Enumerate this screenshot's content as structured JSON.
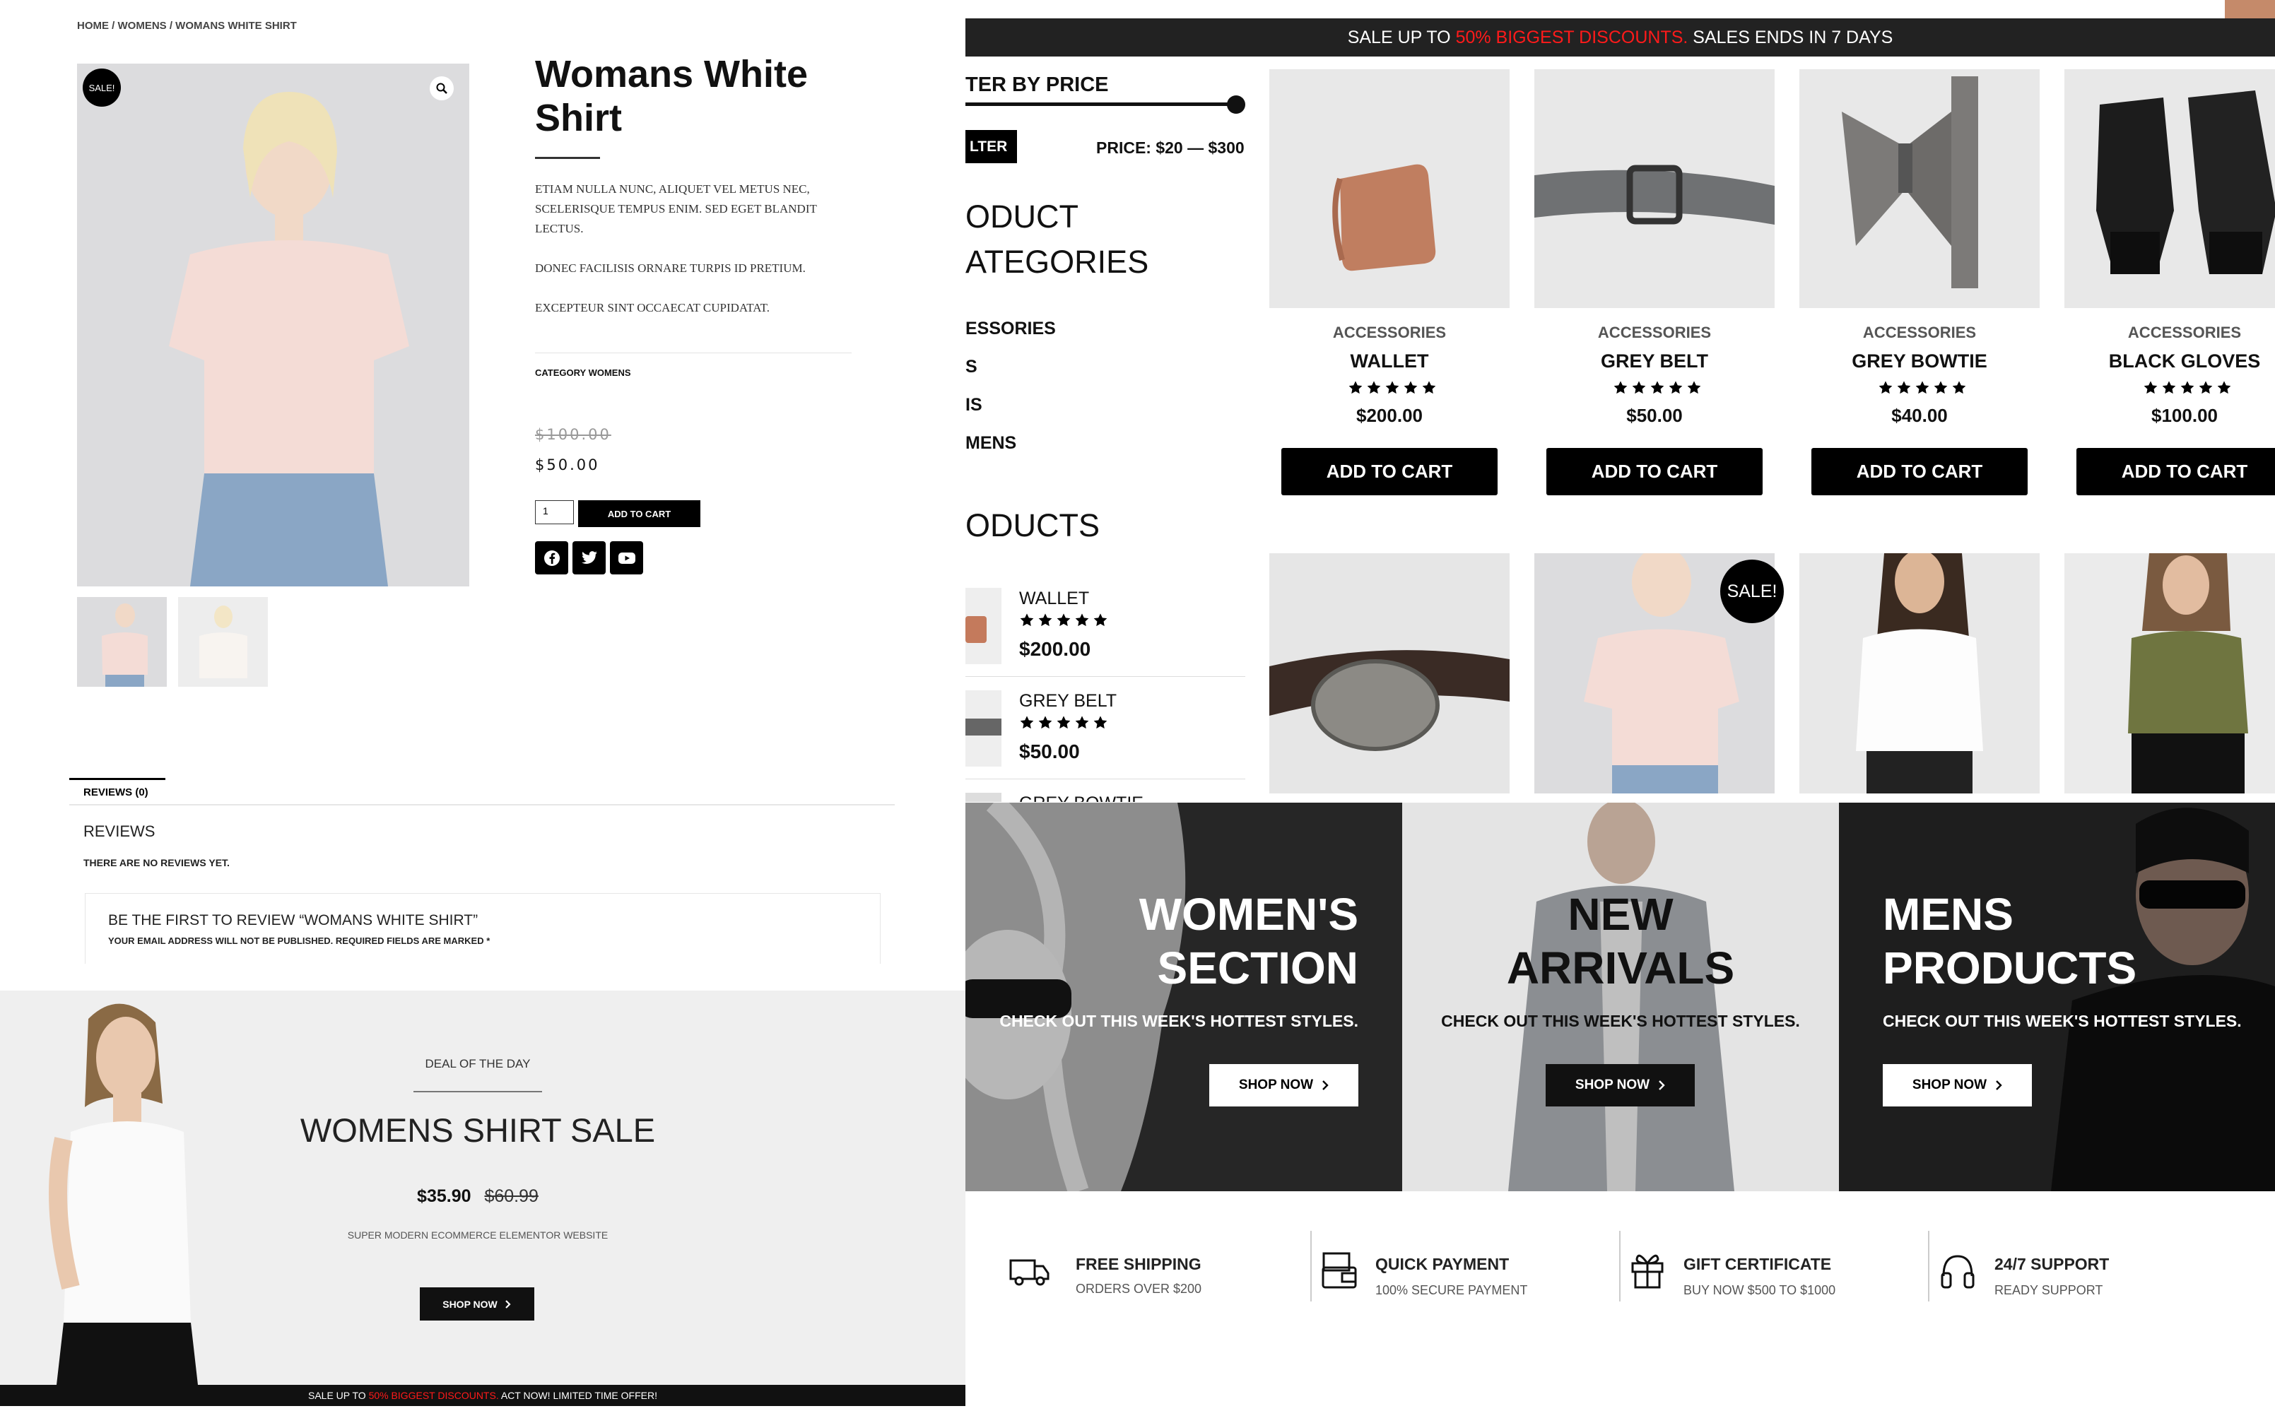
{
  "left": {
    "breadcrumb": "HOME / WOMENS / WOMANS WHITE SHIRT",
    "sale_badge": "SALE!",
    "product": {
      "title_line1": "Womans White",
      "title_line2": "Shirt",
      "desc1_line1": "ETIAM NULLA NUNC, ALIQUET VEL METUS NEC,",
      "desc1_line2": "SCELERISQUE TEMPUS ENIM. SED EGET BLANDIT",
      "desc1_line3": "LECTUS.",
      "desc2": "DONEC FACILISIS ORNARE TURPIS ID PRETIUM.",
      "desc3": "EXCEPTEUR SINT OCCAECAT CUPIDATAT.",
      "category": "CATEGORY WOMENS",
      "old_price": "$100.00",
      "price": "$50.00",
      "qty": "1",
      "add_to_cart": "ADD TO CART"
    },
    "tabs": {
      "reviews_tab": "REVIEWS (0)"
    },
    "reviews": {
      "heading": "REVIEWS",
      "none": "THERE ARE NO REVIEWS YET.",
      "form_title": "BE THE FIRST TO REVIEW “WOMANS WHITE SHIRT”",
      "form_note": "YOUR EMAIL ADDRESS WILL NOT BE PUBLISHED. REQUIRED FIELDS ARE MARKED *"
    },
    "deal": {
      "kicker": "DEAL OF THE DAY",
      "title": "WOMENS SHIRT SALE",
      "price": "$35.90",
      "old_price": "$60.99",
      "sub": "SUPER MODERN ECOMMERCE ELEMENTOR WEBSITE",
      "button": "SHOP NOW"
    },
    "bottom_bar": {
      "pre": "SALE UP TO ",
      "highlight": "50% BIGGEST DISCOUNTS.",
      "post": " ACT NOW! LIMITED TIME OFFER!"
    }
  },
  "right": {
    "top_bar": {
      "pre": "SALE UP TO ",
      "highlight": "50% BIGGEST DISCOUNTS.",
      "post": " SALES ENDS IN 7 DAYS"
    },
    "sidebar": {
      "filter_title": "TER BY PRICE",
      "filter_button": "LTER",
      "price_range": "PRICE: $20 — $300",
      "cat_title_1": "ODUCT",
      "cat_title_2": "ATEGORIES",
      "categories": [
        "ESSORIES",
        "S",
        "IS",
        "MENS"
      ],
      "products_title": "ODUCTS",
      "products": [
        {
          "name": "WALLET",
          "price": "$200.00"
        },
        {
          "name": "GREY BELT",
          "price": "$50.00"
        },
        {
          "name": "GREY BOWTIE",
          "price": ""
        }
      ]
    },
    "products": [
      {
        "category": "ACCESSORIES",
        "name": "WALLET",
        "price": "$200.00",
        "button": "ADD TO CART"
      },
      {
        "category": "ACCESSORIES",
        "name": "GREY BELT",
        "price": "$50.00",
        "button": "ADD TO CART"
      },
      {
        "category": "ACCESSORIES",
        "name": "GREY BOWTIE",
        "price": "$40.00",
        "button": "ADD TO CART"
      },
      {
        "category": "ACCESSORIES",
        "name": "BLACK GLOVES",
        "price": "$100.00",
        "button": "ADD TO CART"
      }
    ],
    "sale_badge": "SALE!",
    "banners": [
      {
        "title_1": "WOMEN'S",
        "title_2": "SECTION",
        "sub": "CHECK OUT THIS WEEK'S HOTTEST STYLES.",
        "button": "SHOP NOW"
      },
      {
        "title_1": "NEW",
        "title_2": "ARRIVALS",
        "sub": "CHECK OUT THIS WEEK'S HOTTEST STYLES.",
        "button": "SHOP NOW"
      },
      {
        "title_1": "MENS",
        "title_2": "PRODUCTS",
        "sub": "CHECK OUT THIS WEEK'S HOTTEST STYLES.",
        "button": "SHOP NOW"
      }
    ],
    "features": [
      {
        "title": "FREE SHIPPING",
        "sub": "ORDERS OVER $200",
        "icon": "truck-icon"
      },
      {
        "title": "QUICK PAYMENT",
        "sub": "100% SECURE PAYMENT",
        "icon": "wallet-icon"
      },
      {
        "title": "GIFT CERTIFICATE",
        "sub": "BUY NOW $500 TO $1000",
        "icon": "gift-icon"
      },
      {
        "title": "24/7 SUPPORT",
        "sub": "READY SUPPORT",
        "icon": "headphones-icon"
      }
    ]
  },
  "colors": {
    "accent_red": "#ff1a1a",
    "dark": "#000000",
    "panel_grey": "#efefef"
  }
}
